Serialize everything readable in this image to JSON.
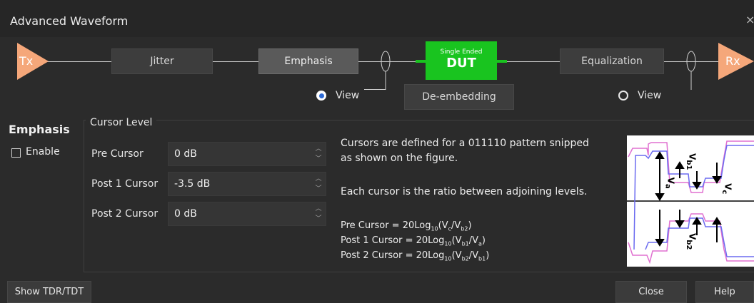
{
  "window": {
    "title": "Advanced Waveform",
    "close_glyph": "×"
  },
  "chain": {
    "tx_label": "Tx",
    "rx_label": "Rx",
    "jitter_label": "Jitter",
    "emphasis_label": "Emphasis",
    "dut_sub_label": "Single Ended",
    "dut_label": "DUT",
    "equalization_label": "Equalization",
    "de_embedding_label": "De-embedding",
    "view_left": {
      "label": "View",
      "selected": true
    },
    "view_right": {
      "label": "View",
      "selected": false
    }
  },
  "emphasis": {
    "section_title": "Emphasis",
    "enable_label": "Enable",
    "enable_checked": false,
    "cursor_level_label": "Cursor Level",
    "fields": [
      {
        "label": "Pre Cursor",
        "value": "0 dB"
      },
      {
        "label": "Post 1 Cursor",
        "value": "-3.5 dB"
      },
      {
        "label": "Post 2 Cursor",
        "value": "0 dB"
      }
    ],
    "desc_line1": "Cursors are defined for a 011110 pattern snipped",
    "desc_line2": "as shown on the figure.",
    "desc_line3": "Each cursor is the ratio between adjoining levels.",
    "formula_pre_label": "Pre Cursor = 20Log",
    "formula_post1_label": "Post 1 Cursor = 20Log",
    "formula_post2_label": "Post 2 Cursor = 20Log",
    "formula_sub": "10",
    "formula_pre_args": [
      "V",
      "c",
      "/V",
      "b2",
      ")"
    ],
    "formula_post1_args": [
      "V",
      "b1",
      "/V",
      "a",
      ")"
    ],
    "formula_post2_args": [
      "V",
      "b2",
      "/V",
      "b1",
      ")"
    ],
    "figure_labels": {
      "va": "V",
      "va_sub": "a",
      "vb1": "V",
      "vb1_sub": "b1",
      "vc": "V",
      "vc_sub": "c",
      "vb2": "V",
      "vb2_sub": "b2"
    },
    "colors": {
      "pink": "#e070d0",
      "blue": "#6b6bf0"
    }
  },
  "footer": {
    "show_tdr_label": "Show TDR/TDT",
    "close_label": "Close",
    "help_label": "Help"
  },
  "colors": {
    "dut_green": "#19c41f",
    "tx_rx_orange": "#f5a77a",
    "radio_blue": "#2e6bd6"
  }
}
